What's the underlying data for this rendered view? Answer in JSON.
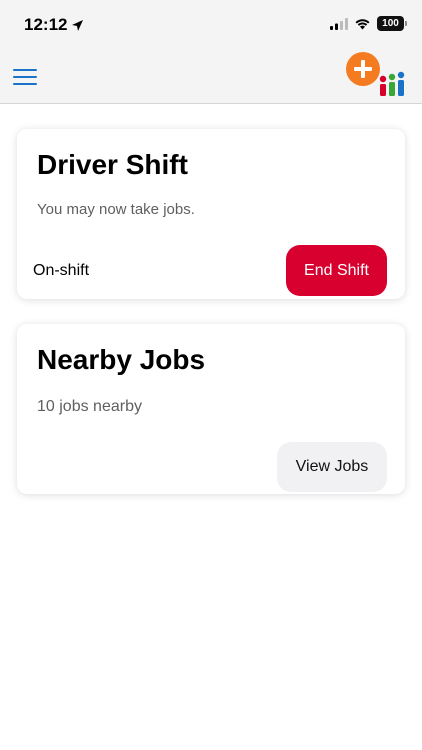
{
  "status_bar": {
    "time": "12:12",
    "battery": "100"
  },
  "header": {
    "menu_icon": "hamburger-menu-icon",
    "logo_icon": "app-logo-icon"
  },
  "colors": {
    "accent_blue": "#1a73c9",
    "end_shift_red": "#d8002e",
    "logo_orange": "#f47b20"
  },
  "driver_shift": {
    "title": "Driver Shift",
    "message": "You may now take jobs.",
    "status": "On-shift",
    "end_button": "End Shift"
  },
  "nearby_jobs": {
    "title": "Nearby Jobs",
    "count_text": "10 jobs nearby",
    "view_button": "View Jobs"
  }
}
